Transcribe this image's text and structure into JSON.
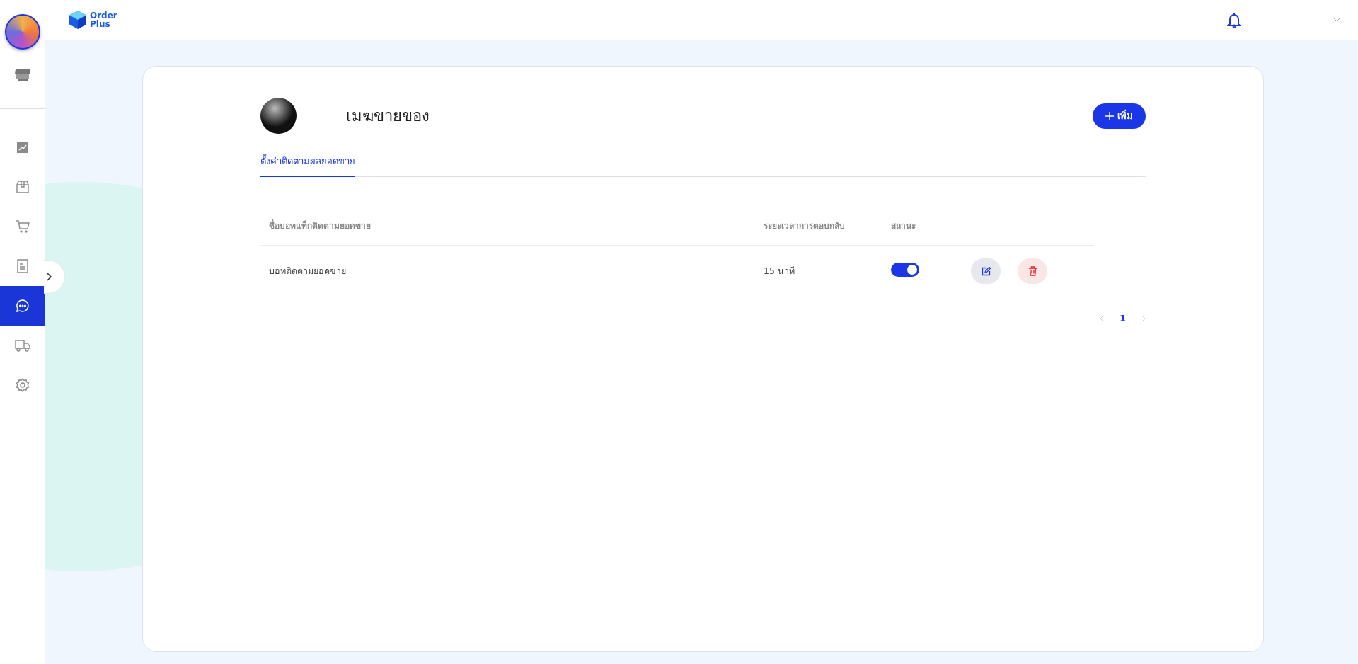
{
  "header": {
    "logo_text": [
      "Order",
      "Plus"
    ]
  },
  "sidebar": {
    "items": [
      {
        "selected": false
      },
      {
        "selected": false
      },
      {
        "selected": false
      },
      {
        "selected": false
      },
      {
        "selected": true
      },
      {
        "selected": false
      },
      {
        "selected": false
      }
    ]
  },
  "page": {
    "title": "เมฆขายของ",
    "add_button": "เพิ่ม",
    "tabs": [
      {
        "label": "ตั้งค่าติดตามผลยอดขาย",
        "selected": true
      }
    ],
    "table": {
      "columns": [
        "ชื่อบอทแท็กติดตามยอดขาย",
        "ระยะเวลาการตอบกลับ",
        "สถานะ"
      ],
      "rows": [
        {
          "name": "บอทติดตามยอดขาย",
          "response_time": "15 นาที",
          "on": true
        }
      ]
    },
    "pagination": {
      "pages": [
        {
          "label": "1",
          "selected": true
        }
      ]
    }
  }
}
